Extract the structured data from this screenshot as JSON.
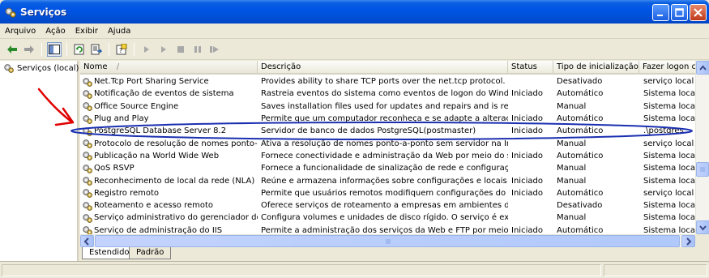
{
  "window": {
    "title": "Serviços"
  },
  "menu": [
    "Arquivo",
    "Ação",
    "Exibir",
    "Ajuda"
  ],
  "toolbar": [
    "back-icon",
    "forward-icon",
    "show-hide-tree-icon",
    "refresh-icon",
    "export-list-icon",
    "help-icon",
    "start-icon",
    "play-icon",
    "stop-icon",
    "pause-icon",
    "restart-icon"
  ],
  "tree": {
    "root_label": "Serviços (local)"
  },
  "columns": [
    "Nome",
    "Descrição",
    "Status",
    "Tipo de inicialização",
    "Fazer logon cor"
  ],
  "sort_indicator": "/",
  "rows": [
    [
      "Net.Tcp Port Sharing Service",
      "Provides ability to share TCP ports over the net.tcp protocol.",
      "",
      "Desativado",
      "serviço local"
    ],
    [
      "Notificação de eventos de sistema",
      "Rastreia eventos do sistema como eventos de logon do Windows, ...",
      "Iniciado",
      "Automático",
      "Sistema local"
    ],
    [
      "Office Source Engine",
      "Saves installation files used for updates and repairs and is require...",
      "",
      "Manual",
      "Sistema local"
    ],
    [
      "Plug and Play",
      "Permite que um computador reconheça e se adapte a alterações d...",
      "Iniciado",
      "Automático",
      "Sistema local"
    ],
    [
      "PostgreSQL Database Server 8.2",
      "Servidor de banco de dados PostgreSQL(postmaster)",
      "Iniciado",
      "Automático",
      ".\\postgres"
    ],
    [
      "Protocolo de resolução de nomes ponto-a-p...",
      "Ativa a resolução de nomes ponto-a-ponto sem servidor na Internet",
      "",
      "Manual",
      "serviço local"
    ],
    [
      "Publicação na World Wide Web",
      "Fornece conectividade e administração da Web por meio do snap-i...",
      "Iniciado",
      "Automático",
      "Sistema local"
    ],
    [
      "QoS RSVP",
      "Fornece a funcionalidade de sinalização de rede e configuração do...",
      "",
      "Manual",
      "Sistema local"
    ],
    [
      "Reconhecimento de local da rede (NLA)",
      "Reúne e armazena informações sobre configurações e locais da re...",
      "Iniciado",
      "Manual",
      "Sistema local"
    ],
    [
      "Registro remoto",
      "Permite que usuários remotos modifiquem configurações do Regist...",
      "Iniciado",
      "Automático",
      "serviço local"
    ],
    [
      "Roteamento e acesso remoto",
      "Oferece serviços de roteamento a empresas em ambientes de red...",
      "",
      "Desativado",
      "Sistema local"
    ],
    [
      "Serviço administrativo do gerenciador de di...",
      "Configura volumes e unidades de disco rígido. O serviço é executa...",
      "",
      "Manual",
      "Sistema local"
    ],
    [
      "Serviço de administração do IIS",
      "Permite a administração dos serviços da Web e FTP por meio do s...",
      "Iniciado",
      "Automático",
      "Sistema local"
    ]
  ],
  "tabs": [
    "Estendido",
    "Padrão"
  ],
  "colors": {
    "title_bar": "#0055e5",
    "annotation_arrow": "#e00000",
    "annotation_ellipse": "#1a2fb0"
  }
}
